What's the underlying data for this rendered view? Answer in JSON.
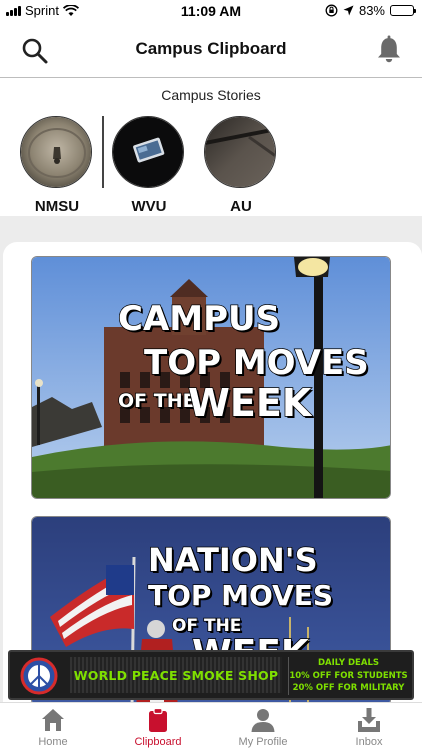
{
  "status_bar": {
    "carrier": "Sprint",
    "time": "11:09 AM",
    "battery": "83%",
    "battery_level": 0.83
  },
  "header": {
    "title": "Campus Clipboard",
    "left_icon": "search-icon",
    "right_icon": "bell-icon"
  },
  "stories": {
    "title": "Campus Stories",
    "items": [
      {
        "label": "NMSU"
      },
      {
        "label": "WVU"
      },
      {
        "label": "AU"
      }
    ]
  },
  "feed": {
    "cards": [
      {
        "lines": [
          "CAMPUS",
          "TOP MOVES",
          "OF THE",
          "WEEK"
        ]
      },
      {
        "lines": [
          "NATION'S",
          "TOP MOVES",
          "OF THE",
          "WEEK"
        ]
      }
    ]
  },
  "ad": {
    "name": "WORLD PEACE SMOKE SHOP",
    "deals": [
      "DAILY DEALS",
      "10% OFF FOR STUDENTS",
      "20% OFF FOR MILITARY"
    ],
    "accent_color": "#7fe000"
  },
  "tab_bar": {
    "active_color": "#c8102e",
    "items": [
      {
        "label": "Home",
        "icon": "home-icon"
      },
      {
        "label": "Clipboard",
        "icon": "clipboard-icon"
      },
      {
        "label": "My Profile",
        "icon": "profile-icon"
      },
      {
        "label": "Inbox",
        "icon": "inbox-icon"
      }
    ]
  }
}
